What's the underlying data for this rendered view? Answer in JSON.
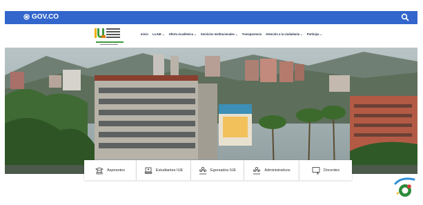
{
  "gov_bar": {
    "brand": "GOV.CO",
    "search_icon": "search-icon",
    "color": "#3366cc"
  },
  "logo": {
    "name": "IUE logo"
  },
  "nav": {
    "items": [
      "Inicio",
      "La IUE ⌄",
      "Oferta Académica ⌄",
      "Servicios Institucionales ⌄",
      "Transparencia",
      "Atención a la ciudadanía ⌄",
      "Participa ⌄"
    ]
  },
  "hero": {
    "image": "campus-building-photo"
  },
  "audience_cards": [
    {
      "label": "Aspirantes",
      "icon": "graduation-cap-icon"
    },
    {
      "label": "Estudiantes IUE",
      "icon": "laptop-student-icon"
    },
    {
      "label": "Egresados IUE",
      "icon": "graduate-group-icon"
    },
    {
      "label": "Administrativos",
      "icon": "staff-group-icon"
    },
    {
      "label": "Docentes",
      "icon": "teacher-board-icon"
    }
  ],
  "chat_widget": {
    "icon": "chat-bubble-icon"
  }
}
